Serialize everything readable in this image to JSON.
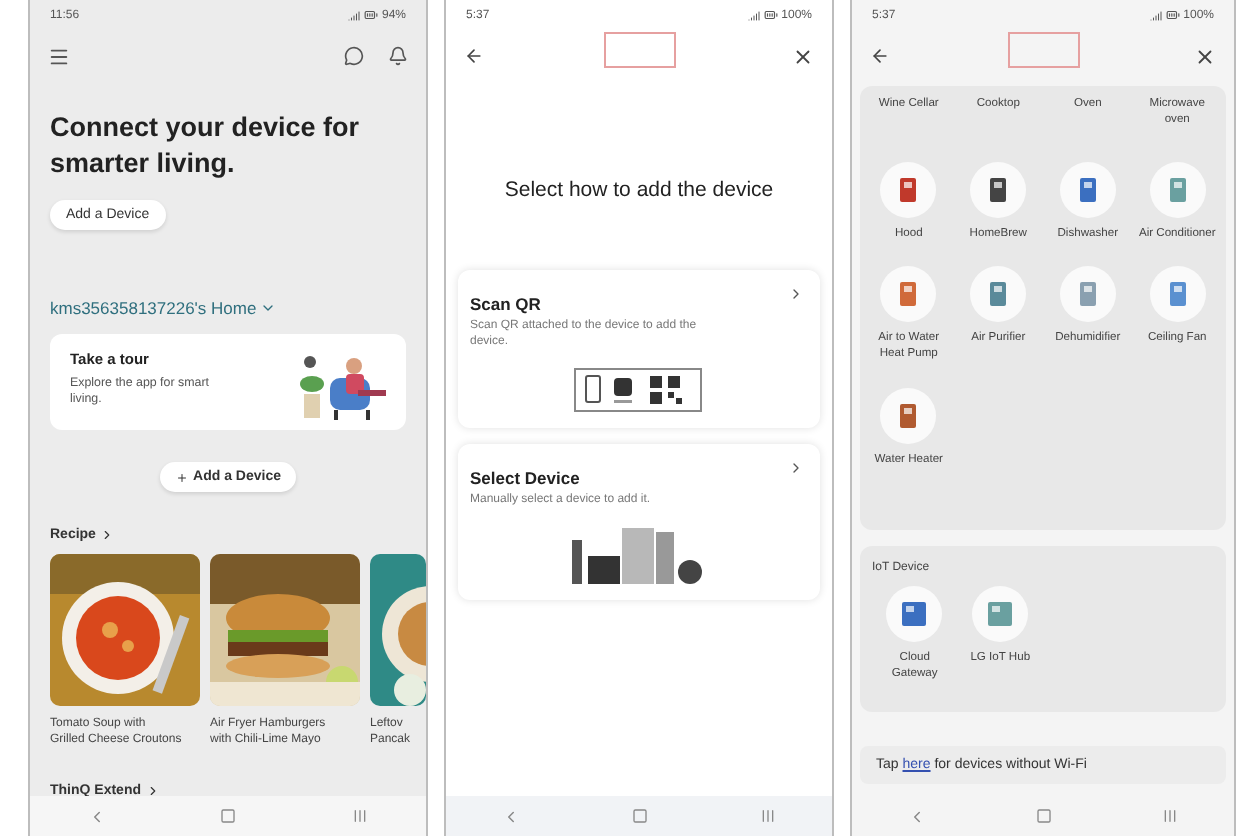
{
  "home_screen": {
    "status_bar": {
      "time": "11:56",
      "battery": "94%"
    },
    "headline": "Connect your device for smarter living.",
    "add_button": "Add a Device",
    "home_name": "kms356358137226's Home",
    "tour_card": {
      "title": "Take a tour",
      "description": "Explore the app for smart living."
    },
    "add_device_button": "Add a Device",
    "recipe_header": "Recipe",
    "recipes": [
      {
        "caption": [
          "Tomato Soup with",
          "Grilled Cheese Croutons"
        ]
      },
      {
        "caption": [
          "Air Fryer Hamburgers",
          "with Chili-Lime Mayo"
        ]
      },
      {
        "caption": [
          "Leftov",
          "Pancak"
        ]
      }
    ],
    "extend_header": "ThinQ Extend"
  },
  "add_method_screen": {
    "status_bar": {
      "time": "5:37",
      "battery": "100%"
    },
    "title": "Select how to add the device",
    "options": [
      {
        "kind": "qr",
        "title": "Scan QR",
        "description": "Scan QR attached to the device to add the device."
      },
      {
        "kind": "manual",
        "title": "Select Device",
        "description": "Manually select a device to add it."
      }
    ]
  },
  "device_list_screen": {
    "status_bar": {
      "time": "5:37",
      "battery": "100%"
    },
    "top_labels": [
      "Wine Cellar",
      "Cooktop",
      "Oven",
      "Microwave oven"
    ],
    "devices": [
      {
        "name": "Hood"
      },
      {
        "name": "HomeBrew"
      },
      {
        "name": "Dishwasher"
      },
      {
        "name": "Air Conditioner"
      },
      {
        "name": "Air to Water Heat Pump"
      },
      {
        "name": "Air Purifier"
      },
      {
        "name": "Dehumidifier"
      },
      {
        "name": "Ceiling Fan"
      },
      {
        "name": "Water Heater"
      }
    ],
    "iot_title": "IoT Device",
    "iot_devices": [
      {
        "name": "Cloud Gateway"
      },
      {
        "name": "LG IoT Hub"
      }
    ],
    "no_wifi": {
      "before": "Tap",
      "link": "here",
      "after": "for devices without Wi-Fi"
    }
  }
}
